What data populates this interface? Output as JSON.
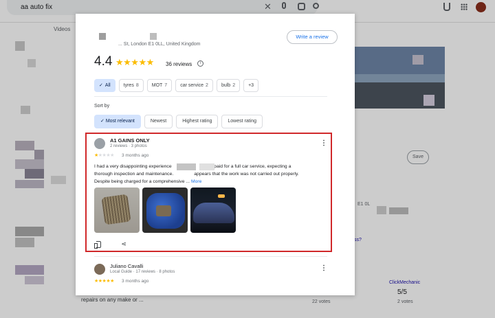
{
  "search": {
    "query": "aa auto fix"
  },
  "background": {
    "tab_videos": "Videos",
    "save_label": "Save",
    "addr_tail": "E1 0L",
    "link_tail": "ss?",
    "click_mechanic": "ClickMechanic",
    "score": "5/5",
    "votes_1": "22 votes",
    "votes_2": "2 votes",
    "snippet": "repairs on any make or ..."
  },
  "dialog": {
    "address": "... St, London E1 0LL, United Kingdom",
    "write_review_label": "Write a review",
    "rating": "4.4",
    "stars": "★★★★★",
    "review_count": "36 reviews",
    "info_icon": "i",
    "filters": [
      {
        "label": "All",
        "count": "",
        "selected": true
      },
      {
        "label": "tyres",
        "count": "8",
        "selected": false
      },
      {
        "label": "MOT",
        "count": "7",
        "selected": false
      },
      {
        "label": "car service",
        "count": "2",
        "selected": false
      },
      {
        "label": "bulb",
        "count": "2",
        "selected": false
      },
      {
        "label": "+3",
        "count": "",
        "selected": false
      }
    ],
    "sort_label": "Sort by",
    "sort_options": [
      {
        "label": "Most relevant",
        "selected": true
      },
      {
        "label": "Newest",
        "selected": false
      },
      {
        "label": "Highest rating",
        "selected": false
      },
      {
        "label": "Lowest rating",
        "selected": false
      }
    ],
    "reviews": [
      {
        "name": "A1 GAINS ONLY",
        "meta": "2 reviews · 3 photos",
        "stars_on": "★",
        "stars_off": "★★★★",
        "time": "3 months ago",
        "text_line1": "I had a very disappointing experience",
        "text_line1b": ". I paid for a full car service, expecting a",
        "text_line2": "thorough inspection and maintenance.",
        "text_line2b": "appears that the work was not carried out properly.",
        "text_line3": "Despite being charged for a comprehensive ...",
        "more_label": "More",
        "photo_count": 3
      },
      {
        "name": "Juliano Cavalli",
        "meta": "Local Guide · 17 reviews · 8 photos",
        "stars_on": "★★★★★",
        "stars_off": "",
        "time": "3 months ago"
      }
    ]
  },
  "colors": {
    "accent": "#1a73e8",
    "star": "#fbbc04",
    "highlight": "#d0282a",
    "chip_selected": "#d3e3fd"
  }
}
